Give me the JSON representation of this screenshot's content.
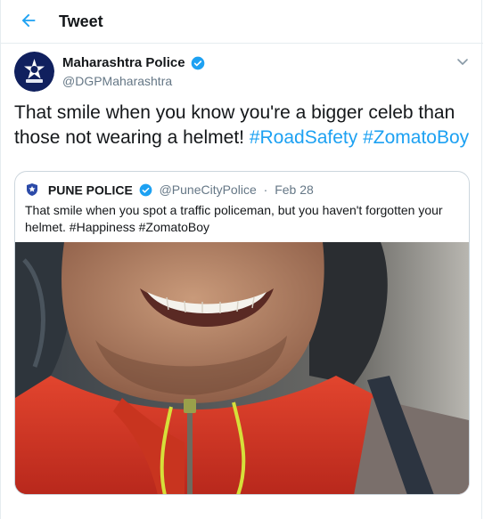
{
  "header": {
    "title": "Tweet"
  },
  "tweet": {
    "author_name": "Maharashtra Police",
    "handle": "@DGPMaharashtra",
    "text_plain": "That smile when you know you're a bigger celeb than those not wearing a helmet! ",
    "hashtags": [
      "#RoadSafety",
      "#ZomatoBoy"
    ]
  },
  "quoted_tweet": {
    "author_name": "PUNE POLICE",
    "handle": "@PuneCityPolice",
    "separator": "·",
    "date": "Feb 28",
    "text": "That smile when you spot a traffic policeman, but you haven't forgotten your helmet. #Happiness #ZomatoBoy"
  },
  "colors": {
    "accent": "#1da1f2",
    "muted": "#657786",
    "border": "#e6ecf0"
  },
  "icons": {
    "back": "arrow-left-icon",
    "verified": "verified-badge-icon",
    "menu": "chevron-down-icon"
  }
}
